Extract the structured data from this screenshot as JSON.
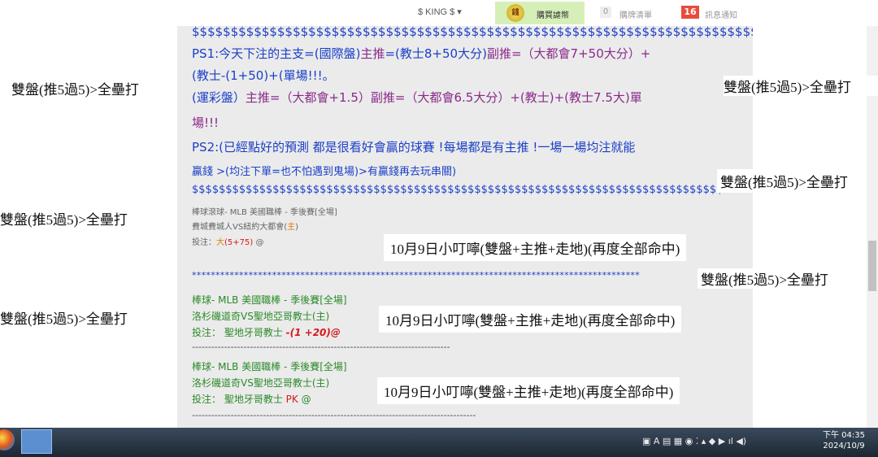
{
  "topbar": {
    "king_label": "$ KING $ ▾",
    "coin_text": "錢",
    "buy_coins": "購買謔幣",
    "cart_count": "0",
    "cart_label": "購牌清單",
    "notif_count": "16",
    "notif_label": "訊息通知"
  },
  "post": {
    "dollars_top": "$$$$$$$$$$$$$$$$$$$$$$$$$$$$$$$$$$$$$$$$$$$$$$$$$$$$$$$$$$$$$$$$$$$$$$$$$",
    "ps1_a1": "PS1:今天下注的主支=(國際盤)",
    "ps1_a2": "主推",
    "ps1_a3": "=(教士8+50大分)",
    "ps1_a4": "副推",
    "ps1_a5": "=（大都會7+50大分）+",
    "ps1_b": "(教士-(1+50)+(單場!!!。",
    "ps1_c1": "(運彩盤）",
    "ps1_c2": "主推",
    "ps1_c3": "=（大都會+1.5）",
    "ps1_c4": "副推",
    "ps1_c5": "=（大都會6.5大分）+(教士)+(教士7.5大)單",
    "ps1_d": "場!!!",
    "ps2_a": "PS2:(已經點好的預測 都是很看好會贏的球賽 !每場都是有主推 !一場一場均注就能",
    "ps2_b": "贏錢 >(均注下單=也不怕遇到鬼場)>有贏錢再去玩串關)",
    "dollars_bottom": "$$$$$$$$$$$$$$$$$$$$$$$$$$$$$$$$$$$$$$$$$$$$$$$$$$$$$$$$$$$$$$$$$$$$$$$$$$$$$$$",
    "bet1_cat": "棒球滾球- MLB 美國職棒 - 季後賽[全場]",
    "bet1_match_a": "費城費城人VS紐約大都會(",
    "bet1_match_b": "主",
    "bet1_match_c": ")",
    "bet1_pick_a": "投注：",
    "bet1_pick_b": "大",
    "bet1_pick_c": "(5+75)",
    "bet1_pick_d": " @",
    "stars": "***********************************************************************************************",
    "bet2_cat": "棒球- MLB 美國職棒 - 季後賽[全場]",
    "bet2_match": "洛杉磯道奇VS聖地亞哥教士(主)",
    "bet2_pick_a": "投注： 聖地牙哥教士 ",
    "bet2_pick_b": "-(1 +20)",
    "bet2_pick_c": "@",
    "dashes": "--------------------------------------------------------------------------------",
    "bet3_cat": "棒球- MLB 美國職棒 - 季後賽[全場]",
    "bet3_match": "洛杉磯道奇VS聖地亞哥教士(主)",
    "bet3_pick_a": "投注： 聖地牙哥教士 ",
    "bet3_pick_b": "PK",
    "bet3_pick_c": " @",
    "dashes2": "----------------------------------------------------------------------------------------"
  },
  "overlays": {
    "double_text": "雙盤(推5過5)>全壘打",
    "result_text": "10月9日小叮嚀(雙盤+主推+走地)(再度全部命中)"
  },
  "tray": {
    "icons": "▣ A ▤ ▦ ◉ ⁚ ▴ ◆ ▶ ıl ◀)",
    "time": "下午 04:35",
    "date": "2024/10/9"
  }
}
